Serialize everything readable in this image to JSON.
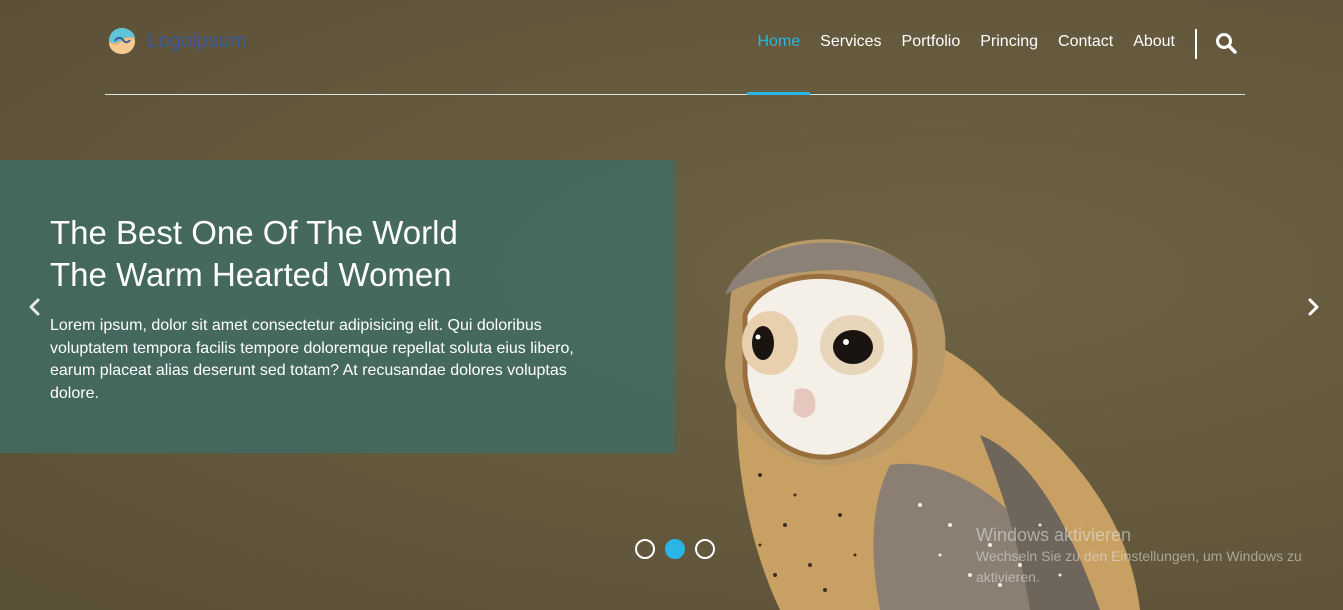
{
  "header": {
    "logo_text": "Logoipsum",
    "nav": [
      "Home",
      "Services",
      "Portfolio",
      "Princing",
      "Contact",
      "About"
    ],
    "active_nav": "Home"
  },
  "slide": {
    "title_line1": "The Best One Of The World",
    "title_line2": "The Warm Hearted Women",
    "text": "Lorem ipsum, dolor sit amet consectetur adipisicing elit. Qui doloribus voluptatem tempora facilis tempore doloremque repellat soluta eius libero, earum placeat alias deserunt sed totam? At recusandae dolores voluptas dolore."
  },
  "carousel": {
    "slide_count": 3,
    "active_index": 2
  },
  "watermark": {
    "title": "Windows aktivieren",
    "text": "Wechseln Sie zu den Einstellungen, um Windows zu aktivieren."
  },
  "colors": {
    "accent": "#29b6e6",
    "caption_bg": "#3e6c64",
    "background": "#675b3f"
  }
}
